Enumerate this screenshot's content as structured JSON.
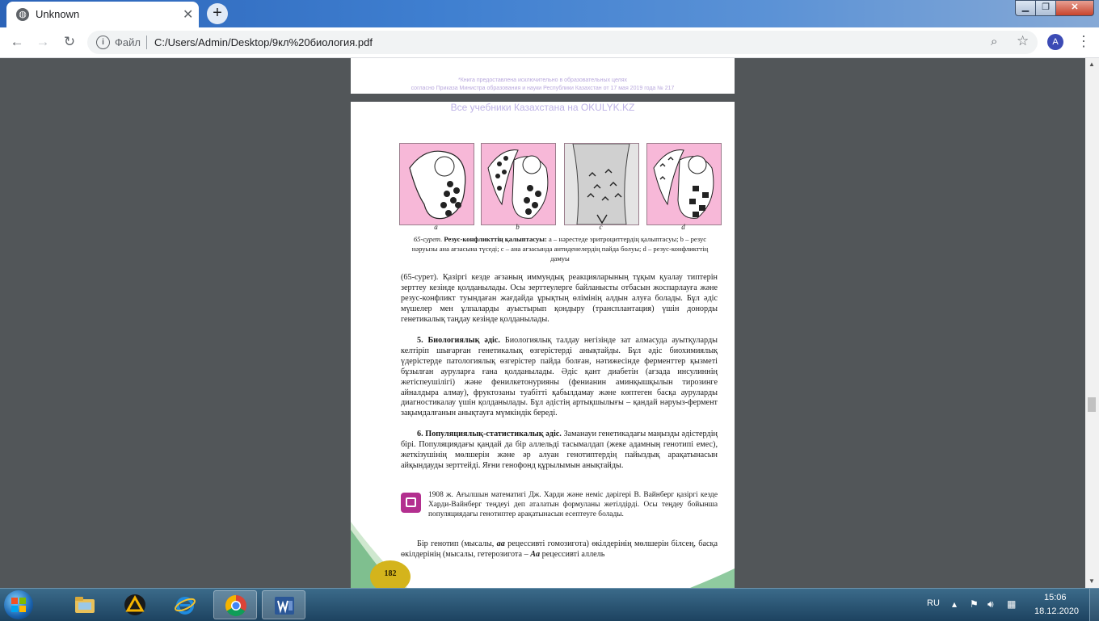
{
  "browser": {
    "tab": {
      "title": "Unknown",
      "close": "✕"
    },
    "new_tab": "+",
    "window_controls": {
      "minimize": "▁",
      "maximize": "❐",
      "close": "✕"
    },
    "omnibox": {
      "prefix": "Файл",
      "url": "C:/Users/Admin/Desktop/9кл%20биология.pdf"
    },
    "profile_initial": "A"
  },
  "pdf": {
    "prev_page_footnote": [
      "*Книга предоставлена исключительно в образовательных целях",
      "согласно Приказа Министра образования и науки Республики Казахстан от 17 мая 2019 года № 217"
    ],
    "watermark": "Все учебники Казахстана на OKULYK.KZ",
    "figure_labels": [
      "a",
      "b",
      "c",
      "d"
    ],
    "caption": {
      "lead": "65-сурет.",
      "title": "Резус-конфликттің қалыптасуы:",
      "rest": "a – нәрестеде эритроциттердің қалыптасуы; b – резус нәруызы ана ағзасына түседі; c – ана ағзасында антиденелердің пайда болуы; d – резус-конфликттің дамуы"
    },
    "para1": "(65-сурет). Қазіргі кезде ағзаның иммундық реакцияларының тұқым қуалау типтерін зерттеу кезінде қолданылады. Осы зерттеулерге байланысты отбасын жоспарлауға және резус-конфликт туындаған жағдайда ұрықтың өлімінің алдын алуға болады. Бұл әдіс мүшелер мен ұлпаларды ауыстырып қондыру (трансплантация) үшін донорды генетикалық таңдау кезінде қолданылады.",
    "para2_title": "5. Биологиялық әдіс.",
    "para2_body": "Биологиялық талдау негізінде зат алмасуда ауытқуларды келтіріп шығарған генетикалық өзгерістерді анықтайды. Бұл әдіс биохимиялық үдерістерде патологиялық өзгерістер пайда болған, нәтижесінде ферменттер қызметі бұзылған ауруларға ғана қолданылады. Әдіс қант диабетін (ағзада инсулиннің жетіспеушілігі) және фенилкетонурияны (фенианин аминқышқылын тирозинге айналдыра алмау), фруктозаны туабітті қабылдамау және көптеген басқа ауруларды диагностикалау үшін қолданылады. Бұл әдістің артықшылығы – қандай нәруыз-фермент зақымдалғанын анықтауға мүмкіндік береді.",
    "para3_title": "6. Популяциялық-статистикалық әдіс.",
    "para3_body": "Заманауи генетикадағы маңызды әдістердің бірі. Популяциядағы қандай да бір аллельді тасымалдап (жеке адамның генотипі емес), жеткізушінің мөлшерін және әр алуан генотиптердің пайыздық арақатынасын айқындауды зерттейді. Яғни генофонд құрылымын анықтайды.",
    "note": "1908 ж. Ағылшын математигі Дж. Харди және неміс дәрігері В. Вайнберг қазіргі кезде Харди-Вайнберг теңдеуі деп аталатын формуланы жетілдірді. Осы теңдеу бойынша популяциядағы генотиптер арақатынасын есептеуге болады.",
    "para4_a": "Бір генотип (мысалы,",
    "para4_b": "aa",
    "para4_c": "рецессивті гомозигота) өкілдерінің мөлшерін білсең, басқа өкілдерінің (мысалы, гетерозигота –",
    "para4_d": "Aa",
    "para4_e": "рецессивті аллель",
    "page_number": "182"
  },
  "taskbar": {
    "language": "RU",
    "time": "15:06",
    "date": "18.12.2020"
  },
  "colors": {
    "figure_bg": "#f7b8d8",
    "note_icon": "#b32f8f",
    "page_badge": "#d4b41c",
    "watermark": "#bdb2e6"
  }
}
